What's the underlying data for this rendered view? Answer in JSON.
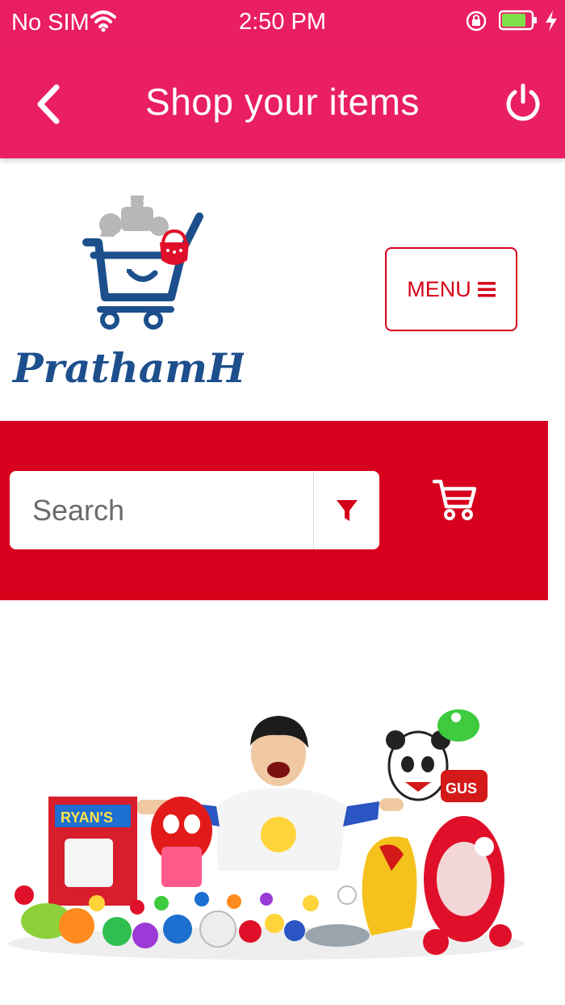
{
  "status_bar": {
    "carrier": "No SIM",
    "time": "2:50 PM"
  },
  "nav": {
    "title": "Shop your items",
    "back_icon": "chevron-left-icon",
    "power_icon": "power-icon",
    "color": "#e91e63"
  },
  "brand": {
    "name": "PrathamHarsh"
  },
  "menu": {
    "label": "MENU"
  },
  "search": {
    "placeholder": "Search",
    "value": "",
    "filter_icon": "filter-icon",
    "cart_icon": "cart-icon",
    "band_color": "#d7001d"
  },
  "hero": {
    "sign_text": "GUS",
    "box_label": "RYAN'S"
  }
}
